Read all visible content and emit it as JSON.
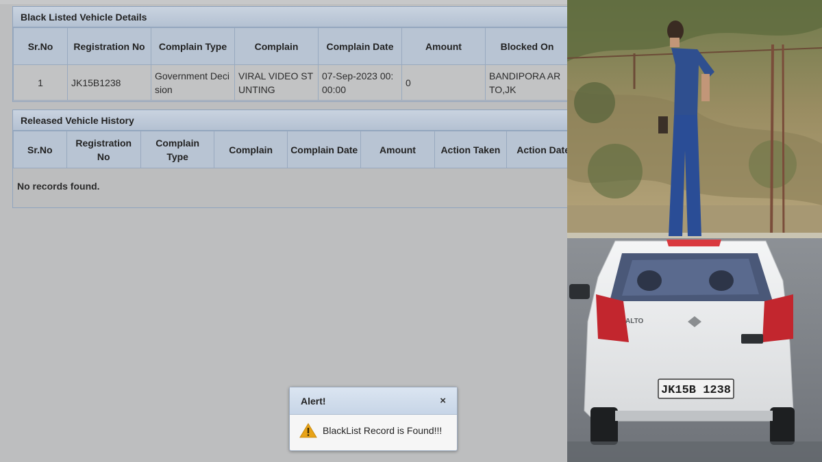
{
  "blacklisted": {
    "title": "Black Listed Vehicle Details",
    "columns": [
      "Sr.No",
      "Registration No",
      "Complain Type",
      "Complain",
      "Complain Date",
      "Amount",
      "Blocked On"
    ],
    "rows": [
      [
        "1",
        "JK15B1238",
        "Government Decision",
        "VIRAL VIDEO STUNTING",
        "07-Sep-2023 00:00:00",
        "0",
        "BANDIPORA ARTO,JK"
      ]
    ]
  },
  "released": {
    "title": "Released Vehicle History",
    "columns": [
      "Sr.No",
      "Registration No",
      "Complain Type",
      "Complain",
      "Complain Date",
      "Amount",
      "Action Taken",
      "Action Date"
    ],
    "empty_message": "No records found."
  },
  "alert": {
    "title": "Alert!",
    "close_symbol": "×",
    "message": "BlackList Record is Found!!!"
  },
  "photo": {
    "car_badge": "ALTO",
    "plate": "JK15B 1238"
  },
  "colors": {
    "page_bg": "#bdbebf",
    "panel_header": "#b4c1d2",
    "table_header": "#b8c4d3",
    "warning": "#e8a317"
  }
}
